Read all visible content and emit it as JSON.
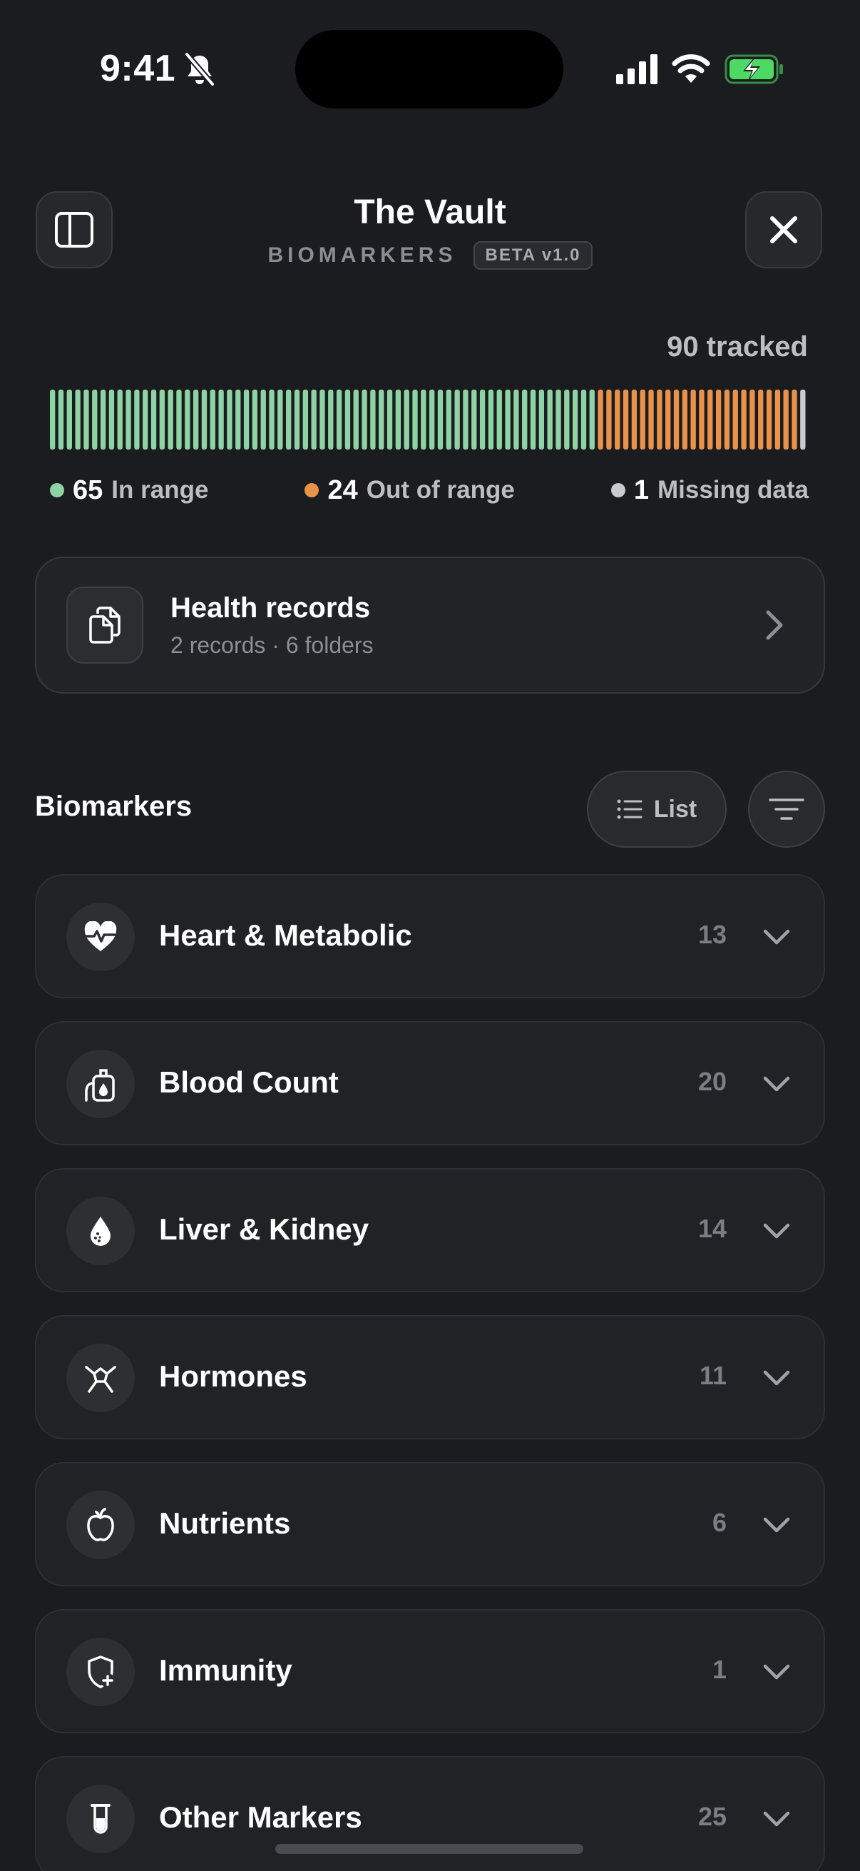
{
  "status_bar": {
    "time": "9:41",
    "icons": [
      "bell-slash-icon",
      "signal-icon",
      "wifi-icon",
      "battery-charging-icon"
    ],
    "battery_color": "#4cd964"
  },
  "header": {
    "title": "The Vault",
    "subtitle": "BIOMARKERS",
    "badge": "BETA v1.0",
    "left_button_icon": "sidebar-icon",
    "right_button_icon": "close-icon"
  },
  "tracker": {
    "total_label": "90 tracked",
    "total": 90,
    "segments": [
      {
        "key": "in_range",
        "count": 65,
        "count_text": "65",
        "label": "In range",
        "color": "#8ed3a3"
      },
      {
        "key": "out_of_range",
        "count": 24,
        "count_text": "24",
        "label": "Out of range",
        "color": "#e99249"
      },
      {
        "key": "missing",
        "count": 1,
        "count_text": "1",
        "label": "Missing data",
        "color": "#c9cbd0"
      }
    ]
  },
  "health_records": {
    "title": "Health records",
    "subtitle": "2 records · 6 folders",
    "icon": "documents-icon"
  },
  "biomarkers": {
    "title": "Biomarkers",
    "list_button": "List",
    "filter_icon": "filter-icon",
    "categories": [
      {
        "label": "Heart & Metabolic",
        "count": "13",
        "icon": "heart-pulse-icon"
      },
      {
        "label": "Blood Count",
        "count": "20",
        "icon": "blood-bag-icon"
      },
      {
        "label": "Liver & Kidney",
        "count": "14",
        "icon": "droplet-icon"
      },
      {
        "label": "Hormones",
        "count": "11",
        "icon": "hormone-icon"
      },
      {
        "label": "Nutrients",
        "count": "6",
        "icon": "apple-icon"
      },
      {
        "label": "Immunity",
        "count": "1",
        "icon": "shield-plus-icon"
      },
      {
        "label": "Other Markers",
        "count": "25",
        "icon": "test-tube-icon"
      }
    ]
  }
}
